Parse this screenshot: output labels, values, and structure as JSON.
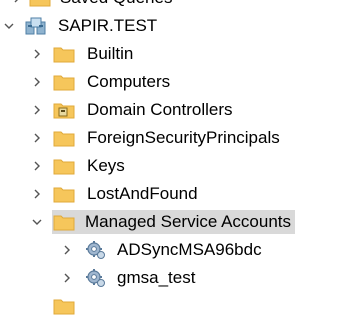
{
  "tree": {
    "items": [
      {
        "label": "Saved Queries",
        "icon": "folder-icon",
        "expanded": false
      },
      {
        "label": "SAPIR.TEST",
        "icon": "domain-icon",
        "expanded": true
      },
      {
        "label": "Builtin",
        "icon": "folder-icon",
        "expanded": false
      },
      {
        "label": "Computers",
        "icon": "folder-icon",
        "expanded": false
      },
      {
        "label": "Domain Controllers",
        "icon": "ou-folder-icon",
        "expanded": false
      },
      {
        "label": "ForeignSecurityPrincipals",
        "icon": "folder-icon",
        "expanded": false
      },
      {
        "label": "Keys",
        "icon": "folder-icon",
        "expanded": false
      },
      {
        "label": "LostAndFound",
        "icon": "folder-icon",
        "expanded": false
      },
      {
        "label": "Managed Service Accounts",
        "icon": "folder-icon",
        "expanded": true,
        "selected": true
      },
      {
        "label": "ADSyncMSA96bdc",
        "icon": "service-account-icon",
        "expanded": false
      },
      {
        "label": "gmsa_test",
        "icon": "service-account-icon",
        "expanded": false
      }
    ]
  },
  "colors": {
    "folder": "#f6c65b",
    "folder_dark": "#e0a93a",
    "selection": "#d9d9d9",
    "chevron": "#555555",
    "gear": "#7a98b8"
  }
}
